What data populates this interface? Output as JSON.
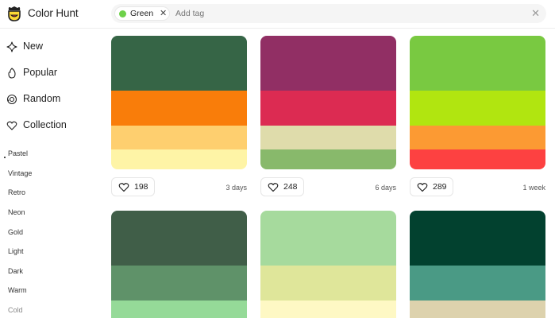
{
  "app": {
    "brand": "Color Hunt",
    "logo_icon": "color-hunt-logo"
  },
  "search": {
    "active_tag": {
      "label": "Green",
      "color": "#6ed14a"
    },
    "placeholder": "Add tag",
    "remove_icon": "close-icon",
    "clear_icon": "close-icon"
  },
  "sidebar": {
    "nav": [
      {
        "label": "New",
        "icon": "sparkle-icon"
      },
      {
        "label": "Popular",
        "icon": "flame-icon"
      },
      {
        "label": "Random",
        "icon": "shuffle-icon"
      },
      {
        "label": "Collection",
        "icon": "heart-icon"
      }
    ],
    "tags": [
      "Pastel",
      "Vintage",
      "Retro",
      "Neon",
      "Gold",
      "Light",
      "Dark",
      "Warm",
      "Cold"
    ]
  },
  "palettes": [
    {
      "colors": [
        "#366546",
        "#f97d0a",
        "#fecf6f",
        "#fef4a6"
      ],
      "likes": "198",
      "age": "3 days"
    },
    {
      "colors": [
        "#912f64",
        "#dc2b52",
        "#dfdcab",
        "#88b96b"
      ],
      "likes": "248",
      "age": "6 days"
    },
    {
      "colors": [
        "#79c941",
        "#b1e510",
        "#fc9a33",
        "#fd4141"
      ],
      "likes": "289",
      "age": "1 week"
    },
    {
      "colors": [
        "#405e48",
        "#5f9269",
        "#95da98",
        "#ffffff"
      ]
    },
    {
      "colors": [
        "#a6da9d",
        "#dfe69a",
        "#fef8c4",
        "#ffffff"
      ]
    },
    {
      "colors": [
        "#02412f",
        "#4a9a85",
        "#ddd2ad",
        "#ffffff"
      ]
    }
  ]
}
